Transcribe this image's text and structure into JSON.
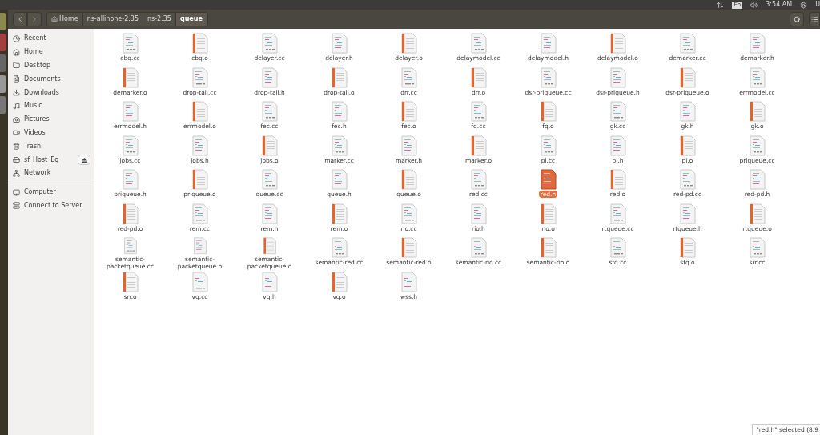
{
  "top_panel": {
    "indicators": [
      {
        "kind": "network"
      },
      {
        "kind": "keyboard",
        "label": "En"
      },
      {
        "kind": "volume"
      },
      {
        "kind": "clock",
        "label": "3:54 AM"
      },
      {
        "kind": "gear",
        "label": "U"
      }
    ]
  },
  "toolbar": {
    "breadcrumbs": [
      {
        "label": "Home",
        "kind": "home",
        "selected": false
      },
      {
        "label": "ns-allinone-2.35",
        "kind": "folder",
        "selected": false
      },
      {
        "label": "ns-2.35",
        "kind": "folder",
        "selected": false
      },
      {
        "label": "queue",
        "kind": "folder",
        "selected": true
      }
    ]
  },
  "sidebar": {
    "groups": [
      [
        {
          "label": "Recent",
          "kind": "recent"
        },
        {
          "label": "Home",
          "kind": "home"
        },
        {
          "label": "Desktop",
          "kind": "desktop"
        },
        {
          "label": "Documents",
          "kind": "documents"
        },
        {
          "label": "Downloads",
          "kind": "downloads"
        },
        {
          "label": "Music",
          "kind": "music"
        },
        {
          "label": "Pictures",
          "kind": "pictures"
        },
        {
          "label": "Videos",
          "kind": "videos"
        },
        {
          "label": "Trash",
          "kind": "trash"
        },
        {
          "label": "sf_Host_Eg",
          "kind": "drive",
          "eject": true
        },
        {
          "label": "Network",
          "kind": "network"
        }
      ],
      [
        {
          "label": "Computer",
          "kind": "computer"
        },
        {
          "label": "Connect to Server",
          "kind": "server"
        }
      ]
    ]
  },
  "files": [
    {
      "name": "cbq.cc",
      "kind": "cc",
      "selected": false
    },
    {
      "name": "cbq.o",
      "kind": "o",
      "selected": false
    },
    {
      "name": "delayer.cc",
      "kind": "cc",
      "selected": false
    },
    {
      "name": "delayer.h",
      "kind": "h",
      "selected": false
    },
    {
      "name": "delayer.o",
      "kind": "o",
      "selected": false
    },
    {
      "name": "delaymodel.cc",
      "kind": "cc",
      "selected": false
    },
    {
      "name": "delaymodel.h",
      "kind": "h",
      "selected": false
    },
    {
      "name": "delaymodel.o",
      "kind": "o",
      "selected": false
    },
    {
      "name": "demarker.cc",
      "kind": "cc",
      "selected": false
    },
    {
      "name": "demarker.h",
      "kind": "h",
      "selected": false
    },
    {
      "name": "demarker.o",
      "kind": "o",
      "selected": false
    },
    {
      "name": "drop-tail.cc",
      "kind": "cc",
      "selected": false
    },
    {
      "name": "drop-tail.h",
      "kind": "h",
      "selected": false
    },
    {
      "name": "drop-tail.o",
      "kind": "o",
      "selected": false
    },
    {
      "name": "drr.cc",
      "kind": "cc",
      "selected": false
    },
    {
      "name": "drr.o",
      "kind": "o",
      "selected": false
    },
    {
      "name": "dsr-priqueue.cc",
      "kind": "cc",
      "selected": false
    },
    {
      "name": "dsr-priqueue.h",
      "kind": "h",
      "selected": false
    },
    {
      "name": "dsr-priqueue.o",
      "kind": "o",
      "selected": false
    },
    {
      "name": "errmodel.cc",
      "kind": "cc",
      "selected": false
    },
    {
      "name": "errmodel.h",
      "kind": "h",
      "selected": false
    },
    {
      "name": "errmodel.o",
      "kind": "o",
      "selected": false
    },
    {
      "name": "fec.cc",
      "kind": "cc",
      "selected": false
    },
    {
      "name": "fec.h",
      "kind": "h",
      "selected": false
    },
    {
      "name": "fec.o",
      "kind": "o",
      "selected": false
    },
    {
      "name": "fq.cc",
      "kind": "cc",
      "selected": false
    },
    {
      "name": "fq.o",
      "kind": "o",
      "selected": false
    },
    {
      "name": "gk.cc",
      "kind": "cc",
      "selected": false
    },
    {
      "name": "gk.h",
      "kind": "h",
      "selected": false
    },
    {
      "name": "gk.o",
      "kind": "o",
      "selected": false
    },
    {
      "name": "jobs.cc",
      "kind": "cc",
      "selected": false
    },
    {
      "name": "jobs.h",
      "kind": "h",
      "selected": false
    },
    {
      "name": "jobs.o",
      "kind": "o",
      "selected": false
    },
    {
      "name": "marker.cc",
      "kind": "cc",
      "selected": false
    },
    {
      "name": "marker.h",
      "kind": "h",
      "selected": false
    },
    {
      "name": "marker.o",
      "kind": "o",
      "selected": false
    },
    {
      "name": "pi.cc",
      "kind": "cc",
      "selected": false
    },
    {
      "name": "pi.h",
      "kind": "h",
      "selected": false
    },
    {
      "name": "pi.o",
      "kind": "o",
      "selected": false
    },
    {
      "name": "priqueue.cc",
      "kind": "cc",
      "selected": false
    },
    {
      "name": "priqueue.h",
      "kind": "h",
      "selected": false
    },
    {
      "name": "priqueue.o",
      "kind": "o",
      "selected": false
    },
    {
      "name": "queue.cc",
      "kind": "cc",
      "selected": false
    },
    {
      "name": "queue.h",
      "kind": "h",
      "selected": false
    },
    {
      "name": "queue.o",
      "kind": "o",
      "selected": false
    },
    {
      "name": "red.cc",
      "kind": "cc",
      "selected": false
    },
    {
      "name": "red.h",
      "kind": "h",
      "selected": true
    },
    {
      "name": "red.o",
      "kind": "o",
      "selected": false
    },
    {
      "name": "red-pd.cc",
      "kind": "cc",
      "selected": false
    },
    {
      "name": "red-pd.h",
      "kind": "h",
      "selected": false
    },
    {
      "name": "red-pd.o",
      "kind": "o",
      "selected": false
    },
    {
      "name": "rem.cc",
      "kind": "cc",
      "selected": false
    },
    {
      "name": "rem.h",
      "kind": "h",
      "selected": false
    },
    {
      "name": "rem.o",
      "kind": "o",
      "selected": false
    },
    {
      "name": "rio.cc",
      "kind": "cc",
      "selected": false
    },
    {
      "name": "rio.h",
      "kind": "h",
      "selected": false
    },
    {
      "name": "rio.o",
      "kind": "o",
      "selected": false
    },
    {
      "name": "rtqueue.cc",
      "kind": "cc",
      "selected": false
    },
    {
      "name": "rtqueue.h",
      "kind": "h",
      "selected": false
    },
    {
      "name": "rtqueue.o",
      "kind": "o",
      "selected": false
    },
    {
      "name": "semantic-packetqueue.cc",
      "kind": "cc",
      "selected": false
    },
    {
      "name": "semantic-packetqueue.h",
      "kind": "h",
      "selected": false
    },
    {
      "name": "semantic-packetqueue.o",
      "kind": "o",
      "selected": false
    },
    {
      "name": "semantic-red.cc",
      "kind": "cc",
      "selected": false
    },
    {
      "name": "semantic-red.o",
      "kind": "o",
      "selected": false
    },
    {
      "name": "semantic-rio.cc",
      "kind": "cc",
      "selected": false
    },
    {
      "name": "semantic-rio.o",
      "kind": "o",
      "selected": false
    },
    {
      "name": "sfq.cc",
      "kind": "cc",
      "selected": false
    },
    {
      "name": "sfq.o",
      "kind": "o",
      "selected": false
    },
    {
      "name": "srr.cc",
      "kind": "cc",
      "selected": false
    },
    {
      "name": "srr.o",
      "kind": "o",
      "selected": false
    },
    {
      "name": "vq.cc",
      "kind": "cc",
      "selected": false
    },
    {
      "name": "vq.h",
      "kind": "h",
      "selected": false
    },
    {
      "name": "vq.o",
      "kind": "o",
      "selected": false
    },
    {
      "name": "wss.h",
      "kind": "h",
      "selected": false
    }
  ],
  "status": "\"red.h\" selected (8.9"
}
